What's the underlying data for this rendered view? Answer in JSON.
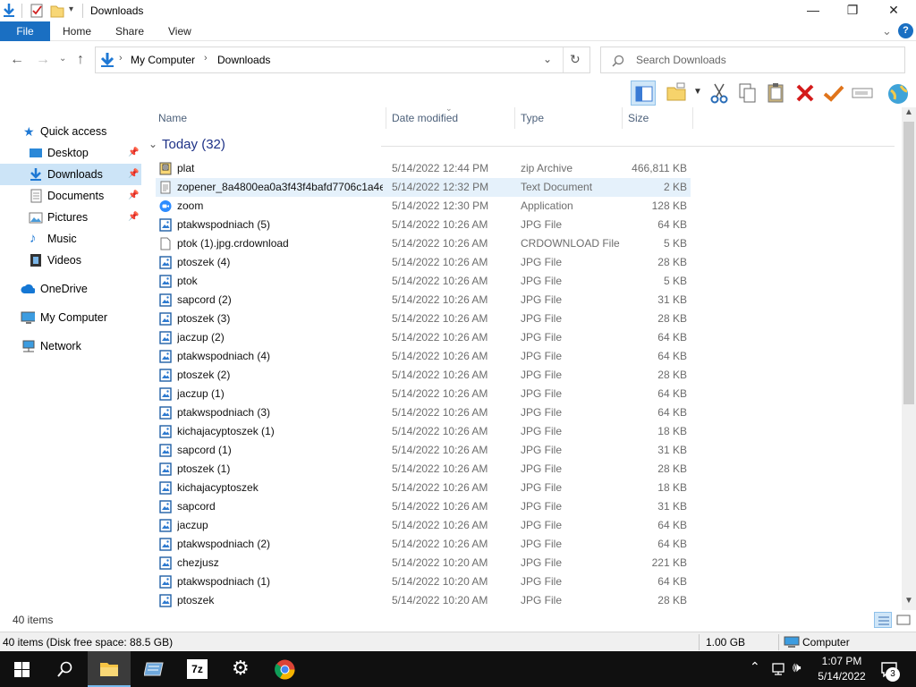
{
  "window": {
    "title": "Downloads",
    "controls": {
      "minimize": "—",
      "maximize": "❐",
      "close": "✕"
    }
  },
  "ribbon": {
    "tabs": [
      "File",
      "Home",
      "Share",
      "View"
    ],
    "help": "?",
    "expand": "⌄"
  },
  "address": {
    "path": [
      "My Computer",
      "Downloads"
    ],
    "separator": "›"
  },
  "search": {
    "placeholder": "Search Downloads"
  },
  "sidebar": {
    "items": [
      {
        "label": "Quick access",
        "icon": "star-icon",
        "pinned": false
      },
      {
        "label": "Desktop",
        "icon": "desktop-icon",
        "pinned": true
      },
      {
        "label": "Downloads",
        "icon": "download-icon",
        "pinned": true,
        "selected": true
      },
      {
        "label": "Documents",
        "icon": "documents-icon",
        "pinned": true
      },
      {
        "label": "Pictures",
        "icon": "pictures-icon",
        "pinned": true
      },
      {
        "label": "Music",
        "icon": "music-icon",
        "pinned": false
      },
      {
        "label": "Videos",
        "icon": "videos-icon",
        "pinned": false
      },
      {
        "label": "OneDrive",
        "icon": "cloud-icon",
        "pinned": false
      },
      {
        "label": "My Computer",
        "icon": "computer-icon",
        "pinned": false
      },
      {
        "label": "Network",
        "icon": "network-icon",
        "pinned": false
      }
    ]
  },
  "columns": {
    "name": "Name",
    "date": "Date modified",
    "type": "Type",
    "size": "Size"
  },
  "group": {
    "title": "Today (32)"
  },
  "files": [
    {
      "name": "plat",
      "date": "5/14/2022 12:44 PM",
      "type": "zip Archive",
      "size": "466,811 KB",
      "icon": "zip-icon"
    },
    {
      "name": "zopener_8a4800ea0a3f43f4bafd7706c1a4e...",
      "date": "5/14/2022 12:32 PM",
      "type": "Text Document",
      "size": "2 KB",
      "icon": "text-file-icon",
      "selected": true
    },
    {
      "name": "zoom",
      "date": "5/14/2022 12:30 PM",
      "type": "Application",
      "size": "128 KB",
      "icon": "zoom-app-icon"
    },
    {
      "name": "ptakwspodniach (5)",
      "date": "5/14/2022 10:26 AM",
      "type": "JPG File",
      "size": "64 KB",
      "icon": "image-file-icon"
    },
    {
      "name": "ptok (1).jpg.crdownload",
      "date": "5/14/2022 10:26 AM",
      "type": "CRDOWNLOAD File",
      "size": "5 KB",
      "icon": "blank-file-icon"
    },
    {
      "name": "ptoszek (4)",
      "date": "5/14/2022 10:26 AM",
      "type": "JPG File",
      "size": "28 KB",
      "icon": "image-file-icon"
    },
    {
      "name": "ptok",
      "date": "5/14/2022 10:26 AM",
      "type": "JPG File",
      "size": "5 KB",
      "icon": "image-file-icon"
    },
    {
      "name": "sapcord (2)",
      "date": "5/14/2022 10:26 AM",
      "type": "JPG File",
      "size": "31 KB",
      "icon": "image-file-icon"
    },
    {
      "name": "ptoszek (3)",
      "date": "5/14/2022 10:26 AM",
      "type": "JPG File",
      "size": "28 KB",
      "icon": "image-file-icon"
    },
    {
      "name": "jaczup (2)",
      "date": "5/14/2022 10:26 AM",
      "type": "JPG File",
      "size": "64 KB",
      "icon": "image-file-icon"
    },
    {
      "name": "ptakwspodniach (4)",
      "date": "5/14/2022 10:26 AM",
      "type": "JPG File",
      "size": "64 KB",
      "icon": "image-file-icon"
    },
    {
      "name": "ptoszek (2)",
      "date": "5/14/2022 10:26 AM",
      "type": "JPG File",
      "size": "28 KB",
      "icon": "image-file-icon"
    },
    {
      "name": "jaczup (1)",
      "date": "5/14/2022 10:26 AM",
      "type": "JPG File",
      "size": "64 KB",
      "icon": "image-file-icon"
    },
    {
      "name": "ptakwspodniach (3)",
      "date": "5/14/2022 10:26 AM",
      "type": "JPG File",
      "size": "64 KB",
      "icon": "image-file-icon"
    },
    {
      "name": "kichajacyptoszek (1)",
      "date": "5/14/2022 10:26 AM",
      "type": "JPG File",
      "size": "18 KB",
      "icon": "image-file-icon"
    },
    {
      "name": "sapcord (1)",
      "date": "5/14/2022 10:26 AM",
      "type": "JPG File",
      "size": "31 KB",
      "icon": "image-file-icon"
    },
    {
      "name": "ptoszek (1)",
      "date": "5/14/2022 10:26 AM",
      "type": "JPG File",
      "size": "28 KB",
      "icon": "image-file-icon"
    },
    {
      "name": "kichajacyptoszek",
      "date": "5/14/2022 10:26 AM",
      "type": "JPG File",
      "size": "18 KB",
      "icon": "image-file-icon"
    },
    {
      "name": "sapcord",
      "date": "5/14/2022 10:26 AM",
      "type": "JPG File",
      "size": "31 KB",
      "icon": "image-file-icon"
    },
    {
      "name": "jaczup",
      "date": "5/14/2022 10:26 AM",
      "type": "JPG File",
      "size": "64 KB",
      "icon": "image-file-icon"
    },
    {
      "name": "ptakwspodniach (2)",
      "date": "5/14/2022 10:26 AM",
      "type": "JPG File",
      "size": "64 KB",
      "icon": "image-file-icon"
    },
    {
      "name": "chezjusz",
      "date": "5/14/2022 10:20 AM",
      "type": "JPG File",
      "size": "221 KB",
      "icon": "image-file-icon"
    },
    {
      "name": "ptakwspodniach (1)",
      "date": "5/14/2022 10:20 AM",
      "type": "JPG File",
      "size": "64 KB",
      "icon": "image-file-icon"
    },
    {
      "name": "ptoszek",
      "date": "5/14/2022 10:20 AM",
      "type": "JPG File",
      "size": "28 KB",
      "icon": "image-file-icon"
    }
  ],
  "footer": {
    "item_count": "40 items"
  },
  "statusbar": {
    "left": "40 items (Disk free space: 88.5 GB)",
    "middle": "1.00 GB",
    "right": "Computer"
  },
  "taskbar": {
    "time": "1:07 PM",
    "date": "5/14/2022",
    "notification_count": "3",
    "apps": [
      "start-icon",
      "search-icon",
      "file-explorer-icon",
      "server-manager-icon",
      "7zip-icon",
      "settings-icon",
      "chrome-icon"
    ],
    "app_label_7z": "7z"
  },
  "colors": {
    "accent": "#1a6fc2",
    "selection": "#cce4f7",
    "group_title": "#1e3287"
  }
}
